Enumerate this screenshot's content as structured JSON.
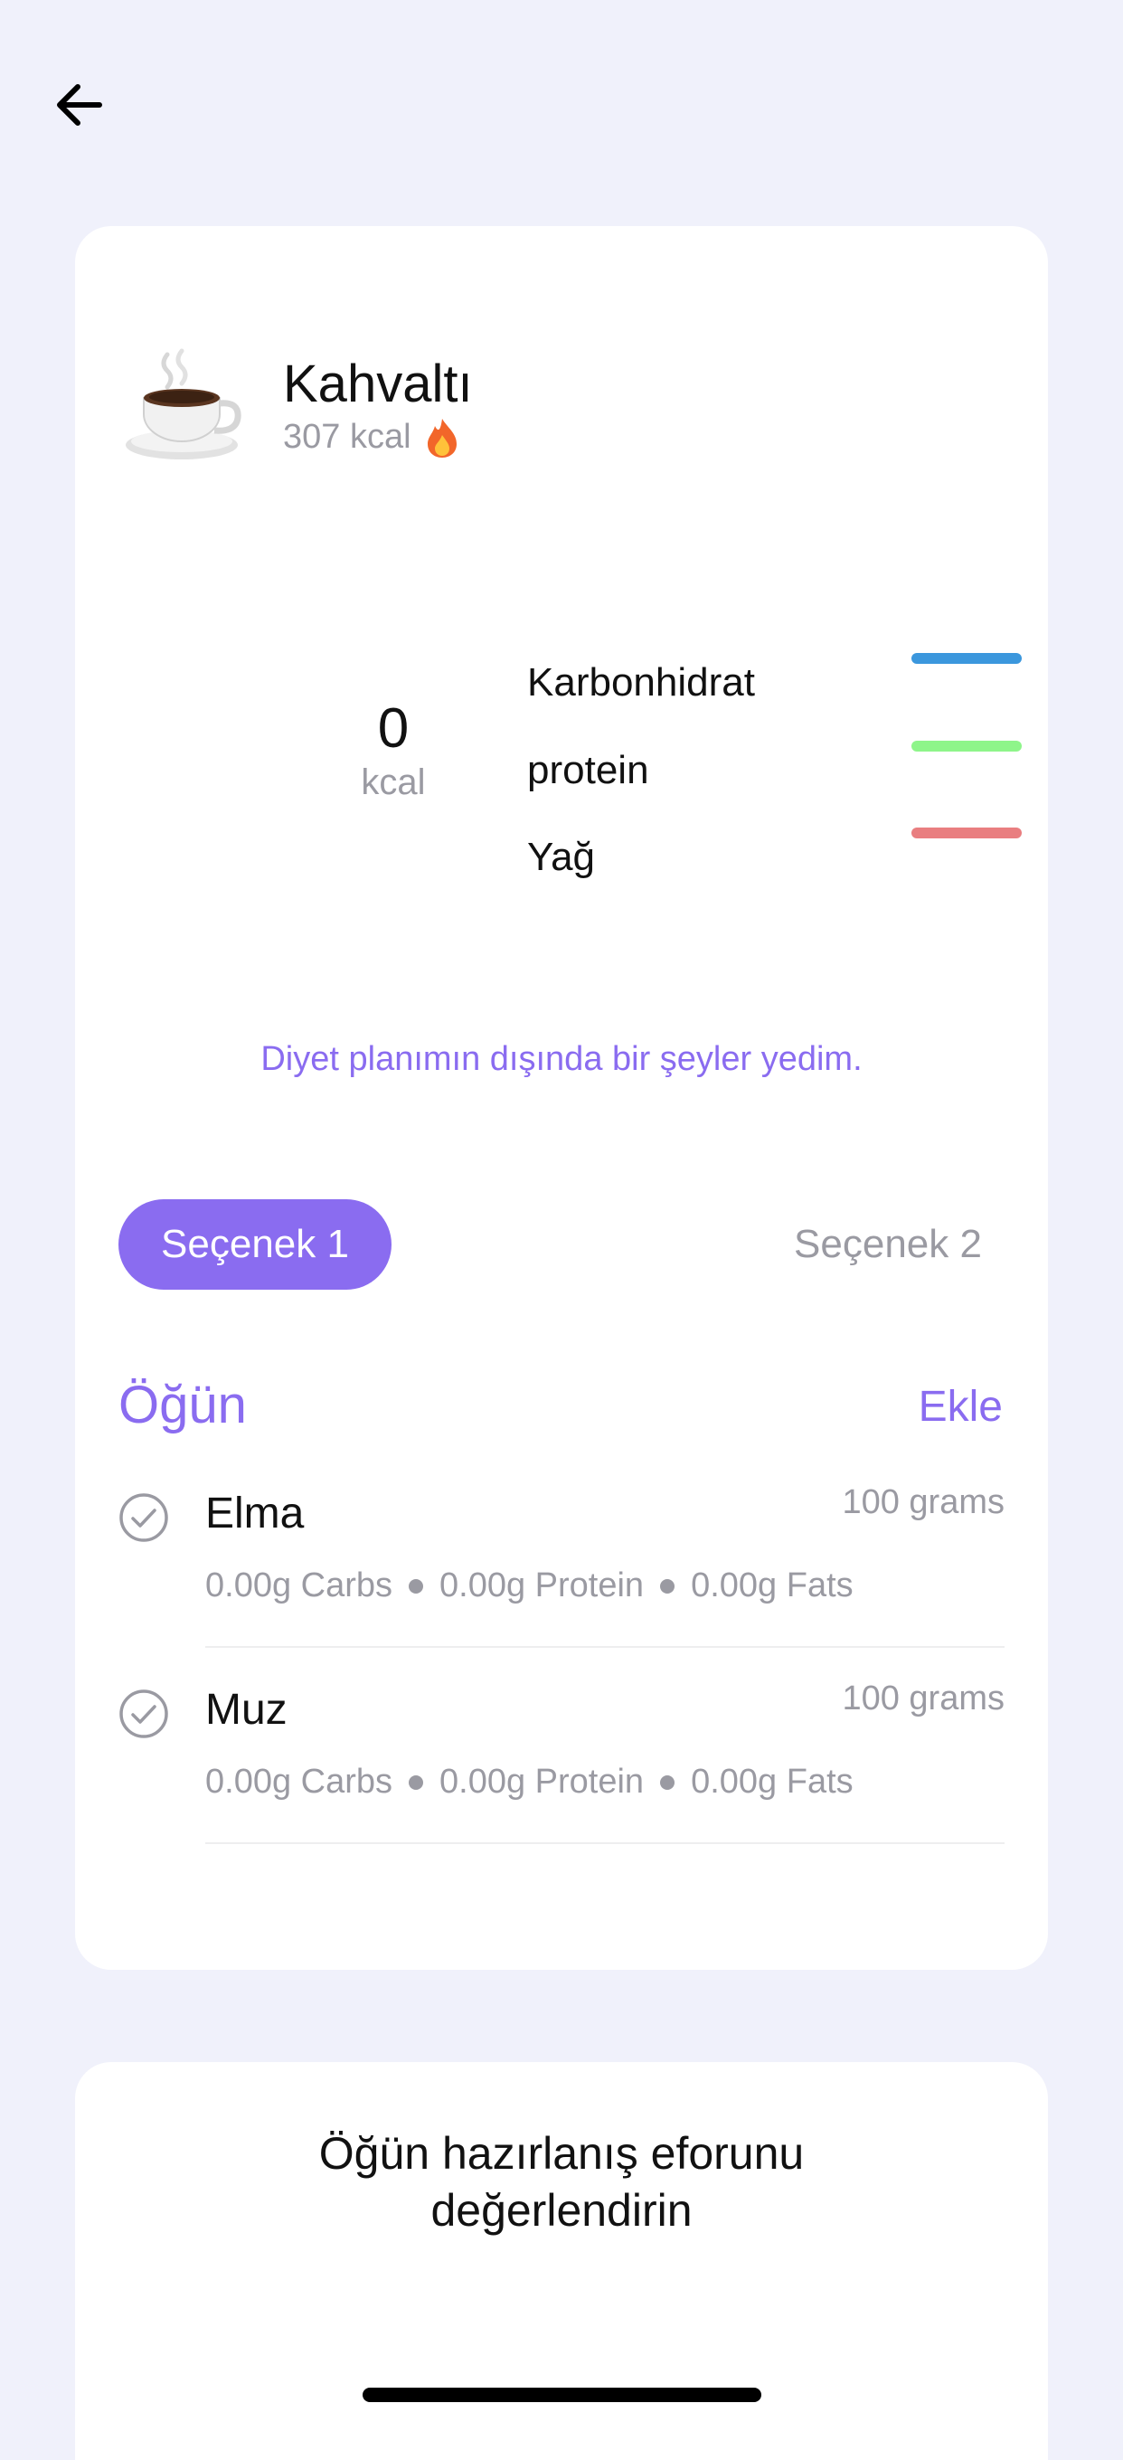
{
  "header": {
    "back_icon": "arrow-left-icon"
  },
  "meal": {
    "icon": "coffee-cup-icon",
    "title": "Kahvaltı",
    "kcal_label": "307 kcal",
    "kcal_icon": "fire-icon"
  },
  "summary": {
    "kcal_value": "0",
    "kcal_unit": "kcal",
    "macros": [
      {
        "label": "Karbonhidrat",
        "color": "#3b97dd"
      },
      {
        "label": "protein",
        "color": "#8ef58a"
      },
      {
        "label": "Yağ",
        "color": "#e97e80"
      }
    ]
  },
  "off_plan_link": "Diyet planımın dışında bir şeyler yedim.",
  "tabs": [
    {
      "label": "Seçenek 1",
      "active": true
    },
    {
      "label": "Seçenek 2",
      "active": false
    }
  ],
  "section": {
    "title": "Öğün",
    "add_label": "Ekle"
  },
  "foods": [
    {
      "name": "Elma",
      "amount": "100 grams",
      "carbs": "0.00g Carbs",
      "protein": "0.00g Protein",
      "fats": "0.00g Fats"
    },
    {
      "name": "Muz",
      "amount": "100 grams",
      "carbs": "0.00g Carbs",
      "protein": "0.00g Protein",
      "fats": "0.00g Fats"
    }
  ],
  "effort": {
    "title_line1": "Öğün hazırlanış eforunu",
    "title_line2": "değerlendirin"
  },
  "colors": {
    "accent": "#8a6cf0",
    "background": "#f0f1fb"
  }
}
